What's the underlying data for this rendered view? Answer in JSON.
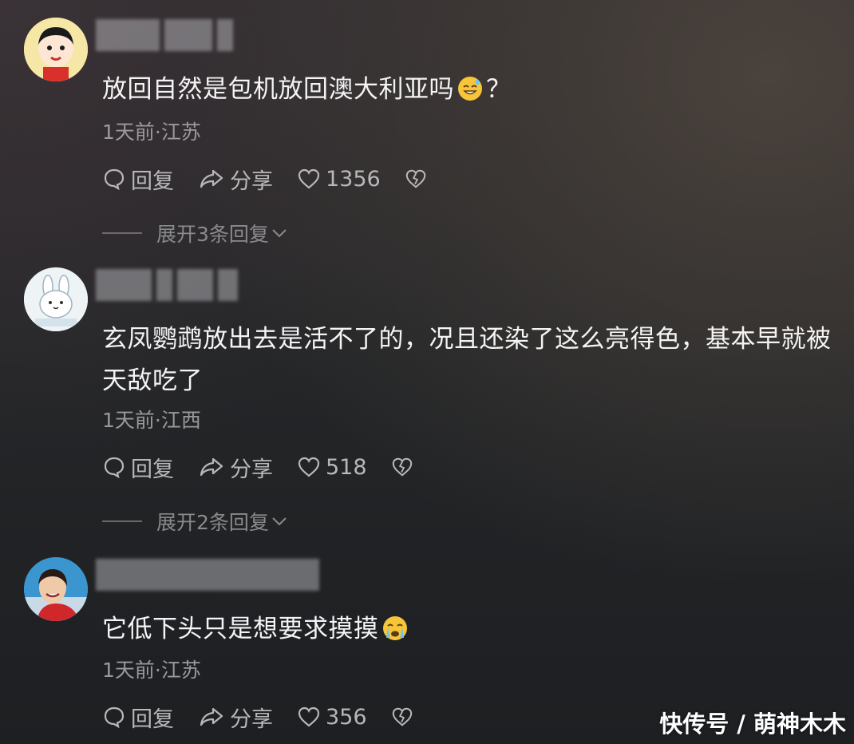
{
  "comments": [
    {
      "text": "放回自然是包机放回澳大利亚吗",
      "text_suffix": "？",
      "emoji": "grinning-sweat-emoji",
      "time_location": "1天前·江苏",
      "reply_label": "回复",
      "share_label": "分享",
      "likes": "1356",
      "expand_label": "展开3条回复"
    },
    {
      "text": "玄凤鹦鹉放出去是活不了的，况且还染了这么亮得色，基本早就被天敌吃了",
      "time_location": "1天前·江西",
      "reply_label": "回复",
      "share_label": "分享",
      "likes": "518",
      "expand_label": "展开2条回复"
    },
    {
      "text": "它低下头只是想要求摸摸",
      "emoji": "crying-face-emoji",
      "time_location": "1天前·江苏",
      "reply_label": "回复",
      "share_label": "分享",
      "likes": "356"
    }
  ],
  "watermark": "快传号 / 萌神木木",
  "colors": {
    "text": "#f4f4f4",
    "meta": "#9a9a9c",
    "action": "#b8b8ba"
  }
}
